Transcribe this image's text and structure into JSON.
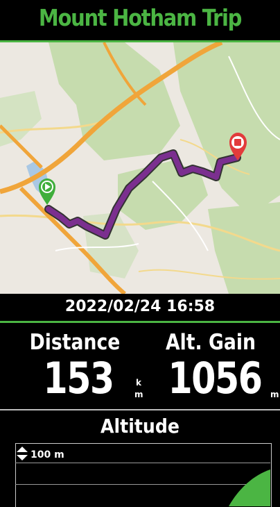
{
  "title": "Mount Hotham Trip",
  "date": "2022/02/24 16:58",
  "stats": {
    "distance": {
      "label": "Distance",
      "value": "153",
      "unit_top": "k",
      "unit_bottom": "m"
    },
    "alt_gain": {
      "label": "Alt. Gain",
      "value": "1056",
      "unit": "m"
    }
  },
  "altitude": {
    "label": "Altitude",
    "scale": "100 m"
  },
  "colors": {
    "accent": "#4bb543",
    "route": "#7b2f8f",
    "start_marker": "#3fae3b",
    "end_marker": "#e23b3b"
  },
  "icons": [
    "start-marker-icon",
    "end-marker-icon",
    "zoom-arrows-icon"
  ]
}
